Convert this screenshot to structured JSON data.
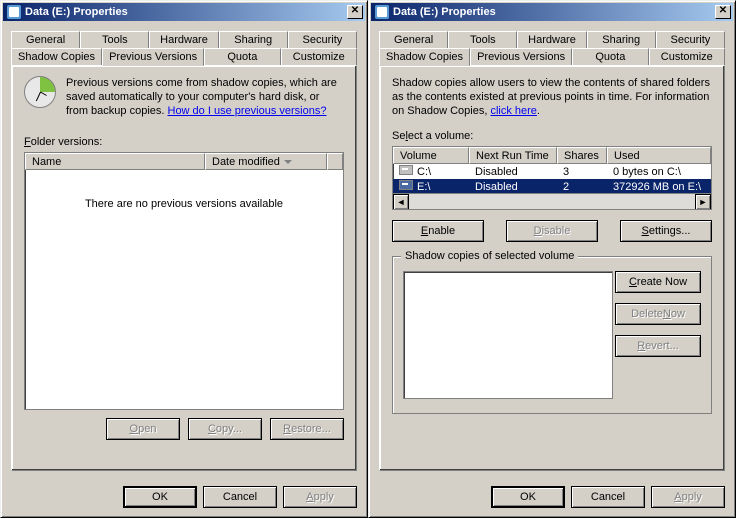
{
  "left": {
    "title": "Data (E:) Properties",
    "tabs_top": [
      "General",
      "Tools",
      "Hardware",
      "Sharing",
      "Security"
    ],
    "tabs_bottom": [
      "Shadow Copies",
      "Previous Versions",
      "Quota",
      "Customize"
    ],
    "active_tab": "Previous Versions",
    "info_text": "Previous versions come from shadow copies, which are saved automatically to your computer's hard disk, or from backup copies. ",
    "info_link": "How do I use previous versions?",
    "folder_versions_label": "Folder versions:",
    "col_name": "Name",
    "col_date": "Date modified",
    "empty_msg": "There are no previous versions available",
    "btn_open": "Open",
    "btn_copy": "Copy...",
    "btn_restore": "Restore...",
    "ok": "OK",
    "cancel": "Cancel",
    "apply": "Apply"
  },
  "right": {
    "title": "Data (E:) Properties",
    "tabs_top": [
      "General",
      "Tools",
      "Hardware",
      "Sharing",
      "Security"
    ],
    "tabs_bottom": [
      "Shadow Copies",
      "Previous Versions",
      "Quota",
      "Customize"
    ],
    "active_tab": "Shadow Copies",
    "info_text": "Shadow copies allow users to view the contents of shared folders as the contents existed at previous points in time. For information on Shadow Copies, ",
    "info_link": "click here",
    "select_label": "Select a volume:",
    "cols": {
      "volume": "Volume",
      "next": "Next Run Time",
      "shares": "Shares",
      "used": "Used"
    },
    "rows": [
      {
        "volume": "C:\\",
        "next": "Disabled",
        "shares": "3",
        "used": "0 bytes on C:\\",
        "selected": false
      },
      {
        "volume": "E:\\",
        "next": "Disabled",
        "shares": "2",
        "used": "372926 MB on E:\\",
        "selected": true
      }
    ],
    "btn_enable": "Enable",
    "btn_disable": "Disable",
    "btn_settings": "Settings...",
    "group_caption": "Shadow copies of selected volume",
    "btn_create": "Create Now",
    "btn_delete": "Delete Now",
    "btn_revert": "Revert...",
    "ok": "OK",
    "cancel": "Cancel",
    "apply": "Apply"
  }
}
